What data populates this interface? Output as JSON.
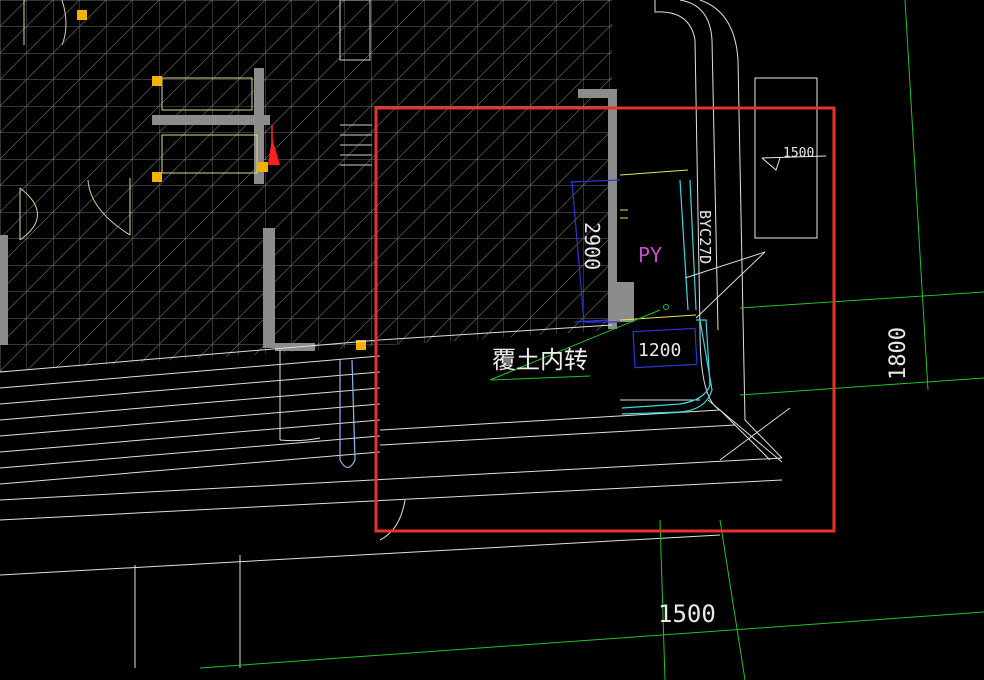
{
  "app": {
    "view": "CAD model space"
  },
  "annotations": {
    "dim_1500_small": "1500",
    "dim_2900": "2900",
    "tag_py": "PY",
    "tag_byc": "BYC27D",
    "callout_text": "覆土内转",
    "dim_1200": "1200",
    "dim_1800": "1800",
    "dim_1500_bottom": "1500"
  },
  "colors": {
    "background": "#000000",
    "wall": "#8c8c8c",
    "grid": "#bdbdbd",
    "line_white": "#e8e8e8",
    "dim_green": "#22c22a",
    "dim_blue": "#2b36d9",
    "tag_magenta": "#d14bd1",
    "cyan": "#38d8e0",
    "yellow": "#e6e65a",
    "highlight_red": "#e8322a",
    "marker_orange": "#f5b000",
    "axis_red": "#ff2020"
  }
}
